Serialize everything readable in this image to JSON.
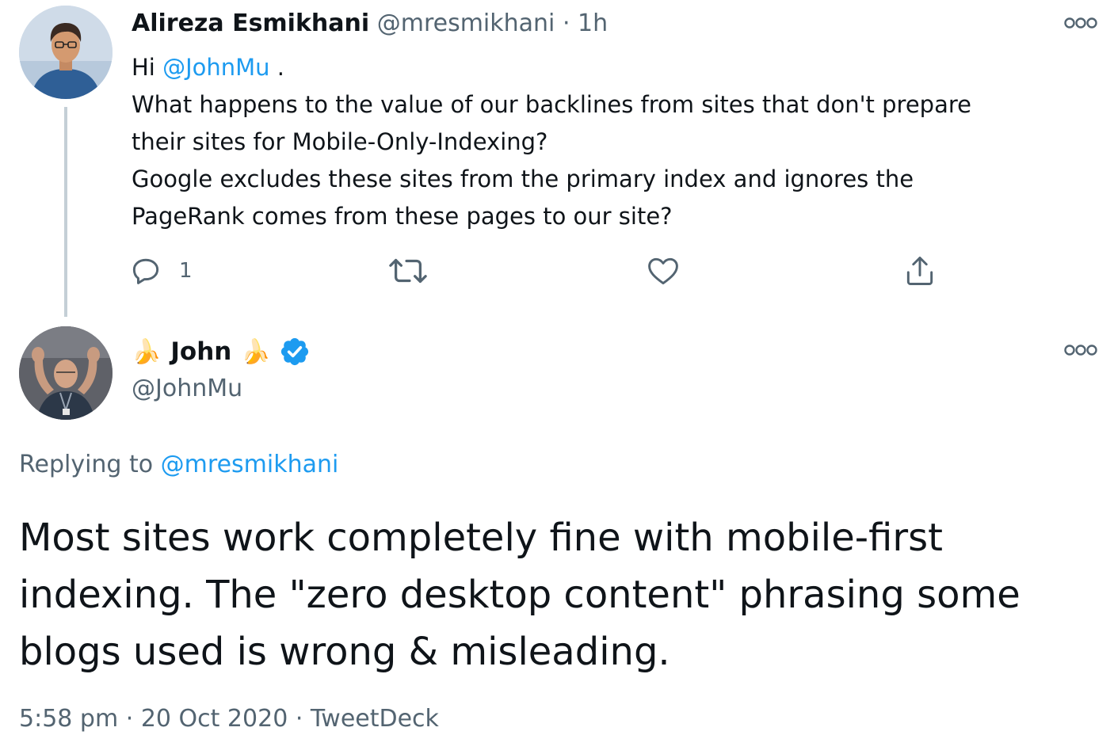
{
  "parent_tweet": {
    "author_name": "Alireza Esmikhani",
    "author_handle": "@mresmikhani",
    "separator": "·",
    "time": "1h",
    "body_greeting": "Hi ",
    "body_mention": "@JohnMu",
    "body_greeting_end": " .",
    "body_lines": [
      "What happens to the value of our backlines from sites that don't prepare",
      "their sites for Mobile-Only-Indexing?",
      "Google excludes these sites from the primary index and ignores the",
      "PageRank comes from these pages to our site?"
    ],
    "reply_count": "1",
    "icons": [
      "reply-icon",
      "retweet-icon",
      "like-icon",
      "share-icon",
      "more-icon"
    ]
  },
  "focused_tweet": {
    "name_prefix_emoji": "🍌",
    "author_name": "John",
    "name_suffix_emoji": "🍌",
    "author_handle": "@JohnMu",
    "verified": true,
    "replying_label": "Replying to ",
    "replying_to": "@mresmikhani",
    "body": "Most sites work completely fine with mobile-first indexing. The \"zero desktop content\" phrasing some blogs used is wrong & misleading.",
    "time": "5:58 pm",
    "meta_separator": "·",
    "date": "20 Oct 2020",
    "source": "TweetDeck"
  },
  "colors": {
    "text": "#0f1419",
    "secondary": "#536471",
    "accent": "#1d9bf0",
    "thread_line": "#c4cfd6"
  }
}
